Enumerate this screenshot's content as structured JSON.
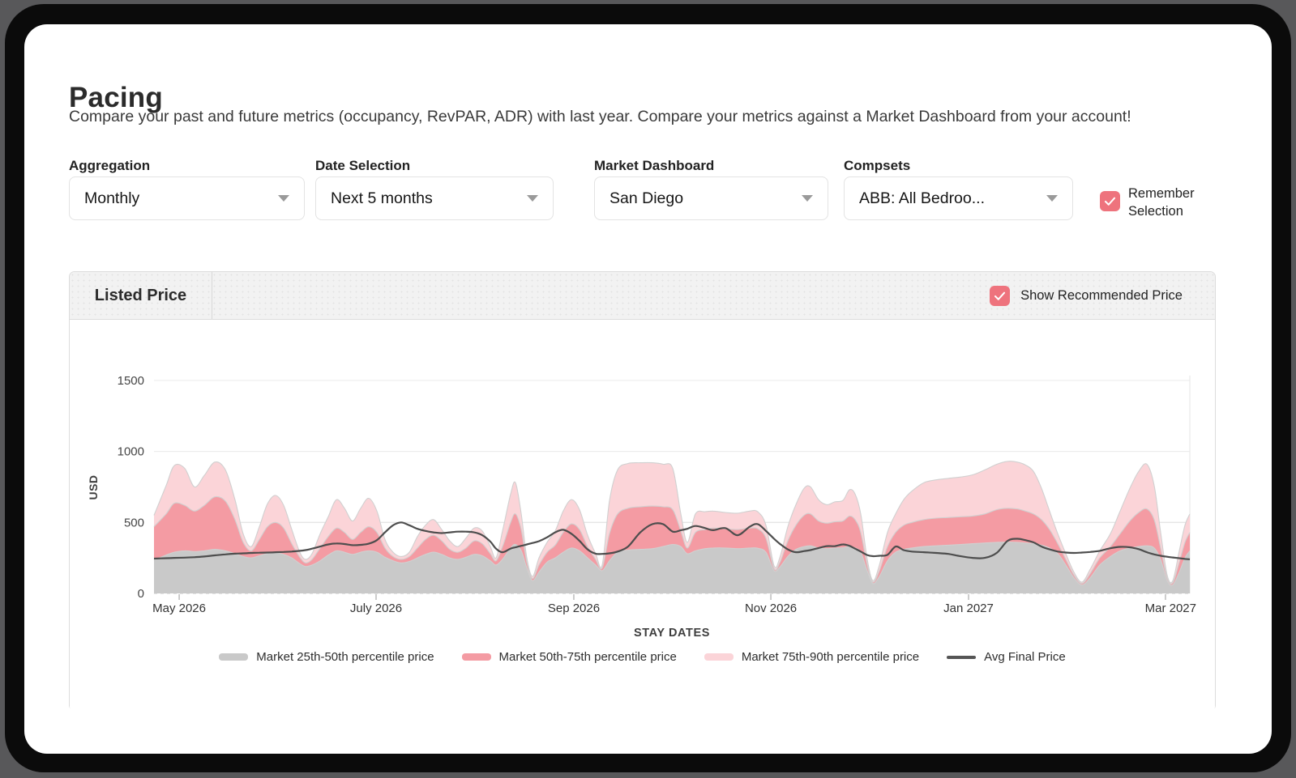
{
  "page": {
    "title": "Pacing",
    "subtitle": "Compare your past and future metrics (occupancy, RevPAR, ADR) with last year. Compare your metrics against  a Market Dashboard from your account!"
  },
  "filters": [
    {
      "label": "Aggregation",
      "value": "Monthly"
    },
    {
      "label": "Date Selection",
      "value": "Next 5 months"
    },
    {
      "label": "Market Dashboard",
      "value": "San Diego"
    },
    {
      "label": "Compsets",
      "value": "ABB: All Bedroo..."
    }
  ],
  "remember": {
    "label": "Remember Selection",
    "checked": true
  },
  "panel": {
    "tab_label": "Listed Price",
    "toggle_label": "Show Recommended Price",
    "toggle_checked": true
  },
  "colors": {
    "accent_pink": "#ee737d",
    "band_gray": "#c9c9c9",
    "band_mid_pink": "#f49ba3",
    "band_light_pink": "#fbd4d8",
    "avg_line": "#4d4d4d"
  },
  "chart_data": {
    "type": "area",
    "xlabel": "STAY DATES",
    "ylabel": "USD",
    "ylim": [
      0,
      1500
    ],
    "yticks": [
      0,
      500,
      1000,
      1500
    ],
    "grid": true,
    "legend_position": "bottom",
    "xticks": [
      {
        "label": "May 2026",
        "f": 0.0243
      },
      {
        "label": "July 2026",
        "f": 0.2144
      },
      {
        "label": "Sep 2026",
        "f": 0.4053
      },
      {
        "label": "Nov 2026",
        "f": 0.5955
      },
      {
        "label": "Jan 2027",
        "f": 0.7864
      },
      {
        "label": "Mar 2027",
        "f": 0.9765
      }
    ],
    "x": [
      0.0,
      0.0117,
      0.0196,
      0.0297,
      0.0391,
      0.0485,
      0.0587,
      0.0689,
      0.0782,
      0.0861,
      0.0939,
      0.1017,
      0.1095,
      0.1174,
      0.1252,
      0.133,
      0.1408,
      0.1463,
      0.1526,
      0.1604,
      0.1682,
      0.1761,
      0.1839,
      0.1917,
      0.1995,
      0.2073,
      0.2152,
      0.223,
      0.2308,
      0.2386,
      0.2465,
      0.2543,
      0.2621,
      0.2699,
      0.2778,
      0.2856,
      0.2934,
      0.3012,
      0.3091,
      0.3169,
      0.3247,
      0.3302,
      0.3365,
      0.3443,
      0.349,
      0.3545,
      0.3599,
      0.3654,
      0.3717,
      0.3795,
      0.3873,
      0.3951,
      0.403,
      0.4108,
      0.4186,
      0.4264,
      0.4327,
      0.4397,
      0.4476,
      0.4577,
      0.4695,
      0.4812,
      0.4914,
      0.5008,
      0.5086,
      0.5149,
      0.5227,
      0.5321,
      0.5399,
      0.5516,
      0.5634,
      0.5751,
      0.5829,
      0.5908,
      0.5986,
      0.6041,
      0.6119,
      0.6197,
      0.6276,
      0.6338,
      0.6416,
      0.6495,
      0.6573,
      0.6651,
      0.6714,
      0.6768,
      0.6823,
      0.6886,
      0.6941,
      0.7003,
      0.7081,
      0.716,
      0.7238,
      0.7316,
      0.7433,
      0.7551,
      0.7668,
      0.7786,
      0.7903,
      0.8021,
      0.8138,
      0.824,
      0.8333,
      0.8412,
      0.849,
      0.8568,
      0.8646,
      0.8725,
      0.8803,
      0.8881,
      0.8959,
      0.9038,
      0.9131,
      0.9233,
      0.9327,
      0.9421,
      0.9507,
      0.9585,
      0.9656,
      0.9718,
      0.9781,
      0.9836,
      0.9898,
      0.9953,
      1.0
    ],
    "series": [
      {
        "name": "Market 25th-50th percentile price",
        "type": "area",
        "color": "#c9c9c9",
        "values": [
          235,
          270,
          290,
          300,
          295,
          300,
          310,
          300,
          280,
          260,
          250,
          265,
          280,
          285,
          275,
          250,
          210,
          190,
          200,
          230,
          270,
          300,
          290,
          275,
          290,
          300,
          290,
          255,
          230,
          215,
          225,
          250,
          275,
          290,
          275,
          250,
          240,
          255,
          275,
          265,
          230,
          200,
          240,
          320,
          345,
          300,
          180,
          90,
          150,
          220,
          250,
          290,
          320,
          300,
          250,
          200,
          160,
          230,
          290,
          305,
          310,
          315,
          330,
          345,
          330,
          280,
          300,
          315,
          320,
          320,
          315,
          320,
          318,
          290,
          160,
          185,
          260,
          310,
          330,
          335,
          320,
          315,
          320,
          322,
          330,
          320,
          290,
          160,
          70,
          120,
          230,
          290,
          310,
          320,
          330,
          335,
          340,
          345,
          350,
          355,
          360,
          362,
          360,
          355,
          350,
          340,
          320,
          280,
          200,
          110,
          60,
          110,
          200,
          260,
          300,
          320,
          330,
          335,
          320,
          240,
          90,
          60,
          150,
          250,
          300
        ]
      },
      {
        "name": "Market 50th-75th percentile price",
        "type": "area",
        "color": "#f49ba3",
        "values": [
          470,
          560,
          635,
          620,
          580,
          620,
          680,
          650,
          520,
          360,
          300,
          380,
          470,
          500,
          460,
          350,
          255,
          215,
          240,
          320,
          400,
          460,
          430,
          380,
          430,
          470,
          430,
          320,
          260,
          240,
          260,
          320,
          380,
          410,
          370,
          310,
          290,
          320,
          370,
          350,
          280,
          230,
          330,
          500,
          560,
          450,
          220,
          105,
          200,
          290,
          340,
          430,
          490,
          450,
          330,
          240,
          180,
          420,
          560,
          600,
          610,
          615,
          610,
          590,
          440,
          320,
          430,
          450,
          460,
          455,
          450,
          460,
          455,
          390,
          175,
          215,
          370,
          480,
          550,
          560,
          510,
          495,
          505,
          510,
          545,
          520,
          430,
          200,
          80,
          160,
          330,
          430,
          480,
          500,
          520,
          530,
          535,
          540,
          545,
          560,
          590,
          600,
          595,
          580,
          560,
          520,
          450,
          350,
          240,
          130,
          70,
          140,
          250,
          330,
          420,
          510,
          570,
          595,
          520,
          320,
          110,
          75,
          220,
          360,
          430
        ]
      },
      {
        "name": "Market 75th-90th percentile price",
        "type": "area",
        "color": "#fbd4d8",
        "values": [
          550,
          760,
          900,
          880,
          750,
          830,
          925,
          870,
          660,
          420,
          330,
          470,
          630,
          690,
          620,
          450,
          290,
          240,
          280,
          420,
          540,
          660,
          600,
          510,
          600,
          670,
          580,
          380,
          290,
          260,
          290,
          400,
          480,
          520,
          450,
          370,
          330,
          390,
          460,
          440,
          330,
          250,
          440,
          700,
          780,
          560,
          250,
          120,
          250,
          360,
          440,
          580,
          660,
          590,
          410,
          280,
          200,
          650,
          870,
          915,
          920,
          920,
          910,
          880,
          560,
          360,
          560,
          575,
          580,
          570,
          565,
          580,
          575,
          480,
          195,
          250,
          470,
          625,
          740,
          750,
          660,
          625,
          645,
          655,
          730,
          700,
          560,
          240,
          90,
          200,
          430,
          560,
          660,
          720,
          780,
          800,
          810,
          820,
          835,
          870,
          910,
          930,
          925,
          905,
          860,
          740,
          580,
          420,
          280,
          150,
          80,
          170,
          300,
          420,
          580,
          740,
          860,
          910,
          760,
          430,
          130,
          90,
          300,
          480,
          560
        ]
      },
      {
        "name": "Avg Final Price",
        "type": "line",
        "color": "#4d4d4d",
        "values": [
          245,
          248,
          250,
          252,
          255,
          260,
          268,
          275,
          280,
          282,
          285,
          287,
          288,
          290,
          292,
          295,
          300,
          305,
          315,
          330,
          345,
          352,
          348,
          340,
          342,
          350,
          375,
          430,
          480,
          500,
          480,
          455,
          440,
          430,
          425,
          430,
          435,
          435,
          430,
          410,
          365,
          315,
          290,
          316,
          325,
          335,
          345,
          355,
          368,
          395,
          430,
          448,
          420,
          370,
          310,
          280,
          278,
          282,
          295,
          330,
          430,
          488,
          488,
          435,
          445,
          455,
          475,
          460,
          445,
          460,
          410,
          470,
          488,
          440,
          385,
          350,
          310,
          290,
          298,
          305,
          320,
          333,
          333,
          345,
          335,
          315,
          295,
          270,
          262,
          265,
          272,
          330,
          305,
          295,
          290,
          285,
          278,
          262,
          250,
          250,
          287,
          370,
          385,
          375,
          360,
          330,
          310,
          295,
          288,
          285,
          288,
          292,
          300,
          318,
          328,
          325,
          312,
          290,
          275,
          265,
          258,
          253,
          248,
          243,
          240
        ]
      }
    ]
  }
}
